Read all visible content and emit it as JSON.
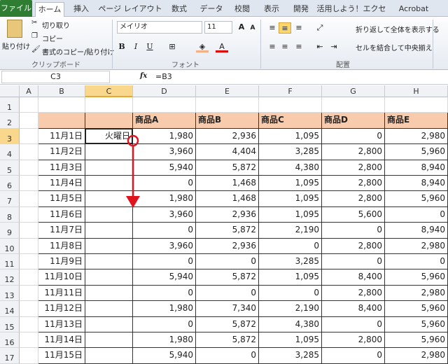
{
  "tabs": [
    "ファイル",
    "ホーム",
    "挿入",
    "ページ レイアウト",
    "数式",
    "データ",
    "校閲",
    "表示",
    "開発",
    "活用しよう！エクセル",
    "Acrobat"
  ],
  "ribbon": {
    "paste": "貼り付け",
    "cut": "切り取り",
    "copy": "コピー",
    "format_painter": "書式のコピー/貼り付け",
    "clipboard_group": "クリップボード",
    "font_name": "メイリオ",
    "font_size": "11",
    "font_group": "フォント",
    "wrap_text": "折り返して全体を表示する",
    "merge_center": "セルを結合して中央揃え",
    "alignment_group": "配置",
    "bold": "B",
    "italic": "I",
    "underline": "U"
  },
  "formula_bar": {
    "name_box": "C3",
    "fx": "fx",
    "formula": "=B3"
  },
  "columns": [
    "A",
    "B",
    "C",
    "D",
    "E",
    "F",
    "G",
    "H"
  ],
  "selected_column": "C",
  "selected_row": 3,
  "table": {
    "headers": [
      "",
      "",
      "商品A",
      "商品B",
      "商品C",
      "商品D",
      "商品E"
    ],
    "rows": [
      [
        "11月1日",
        "火曜日",
        "1,980",
        "2,936",
        "1,095",
        "0",
        "2,980"
      ],
      [
        "11月2日",
        "",
        "3,960",
        "4,404",
        "3,285",
        "2,800",
        "5,960"
      ],
      [
        "11月3日",
        "",
        "5,940",
        "5,872",
        "4,380",
        "2,800",
        "8,940"
      ],
      [
        "11月4日",
        "",
        "0",
        "1,468",
        "1,095",
        "2,800",
        "8,940"
      ],
      [
        "11月5日",
        "",
        "1,980",
        "1,468",
        "1,095",
        "2,800",
        "5,960"
      ],
      [
        "11月6日",
        "",
        "3,960",
        "2,936",
        "1,095",
        "5,600",
        "0"
      ],
      [
        "11月7日",
        "",
        "0",
        "5,872",
        "2,190",
        "0",
        "8,940"
      ],
      [
        "11月8日",
        "",
        "3,960",
        "2,936",
        "0",
        "2,800",
        "2,980"
      ],
      [
        "11月9日",
        "",
        "0",
        "0",
        "3,285",
        "0",
        "0"
      ],
      [
        "11月10日",
        "",
        "5,940",
        "5,872",
        "1,095",
        "8,400",
        "5,960"
      ],
      [
        "11月11日",
        "",
        "0",
        "0",
        "0",
        "2,800",
        "2,980"
      ],
      [
        "11月12日",
        "",
        "1,980",
        "7,340",
        "2,190",
        "8,400",
        "5,960"
      ],
      [
        "11月13日",
        "",
        "0",
        "5,872",
        "4,380",
        "0",
        "5,960"
      ],
      [
        "11月14日",
        "",
        "1,980",
        "5,872",
        "1,095",
        "2,800",
        "5,960"
      ],
      [
        "11月15日",
        "",
        "5,940",
        "0",
        "3,285",
        "0",
        "2,980"
      ]
    ]
  },
  "colors": {
    "header_fill": "#f8cbad",
    "annotation": "#e0141e",
    "file_tab": "#2f7c33",
    "selected_header": "#f9d88e"
  }
}
